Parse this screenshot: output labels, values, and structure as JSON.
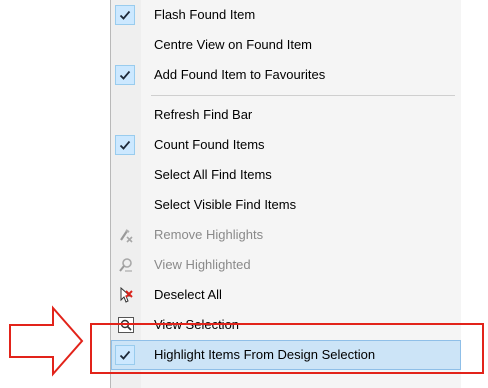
{
  "menu": {
    "items": [
      {
        "label": "Flash Found Item",
        "checked": true,
        "icon": "check-icon"
      },
      {
        "label": "Centre View on Found Item",
        "checked": false
      },
      {
        "label": "Add Found Item to Favourites",
        "checked": true,
        "icon": "check-icon"
      },
      {
        "label": "Refresh Find Bar",
        "checked": false
      },
      {
        "label": "Count Found Items",
        "checked": true,
        "icon": "check-icon"
      },
      {
        "label": "Select All Find Items",
        "checked": false
      },
      {
        "label": "Select Visible Find Items",
        "checked": false
      },
      {
        "label": "Remove Highlights",
        "disabled": true,
        "icon": "remove-highlight-icon"
      },
      {
        "label": "View Highlighted",
        "disabled": true,
        "icon": "view-highlighted-icon"
      },
      {
        "label": "Deselect All",
        "icon": "deselect-icon"
      },
      {
        "label": "View Selection",
        "icon": "view-selection-icon"
      },
      {
        "label": "Highlight Items From Design Selection",
        "checked": true,
        "highlighted": true,
        "icon": "check-icon"
      }
    ]
  },
  "colors": {
    "annotation": "#e2231a",
    "highlight": "#cce4f7",
    "check_box": "#cce8ff",
    "disabled_text": "#8a8a8a"
  }
}
